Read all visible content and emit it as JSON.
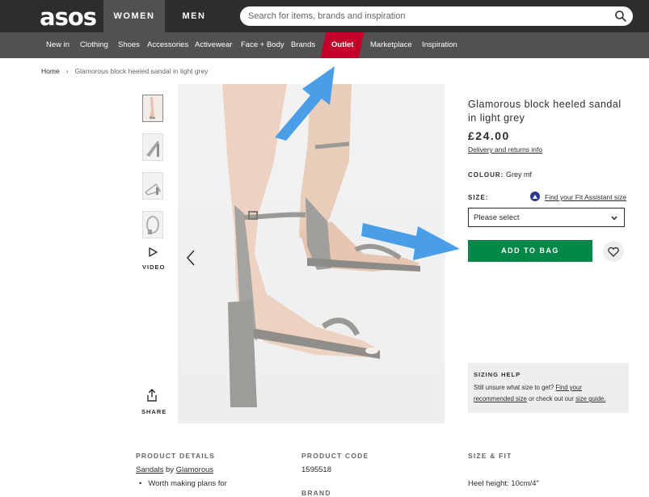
{
  "header": {
    "logo": "asos",
    "tab_women": "WOMEN",
    "tab_men": "MEN",
    "search_placeholder": "Search for items, brands and inspiration"
  },
  "nav": {
    "items": [
      "New in",
      "Clothing",
      "Shoes",
      "Accessories",
      "Activewear",
      "Face + Body",
      "Brands",
      "Outlet",
      "Marketplace",
      "Inspiration"
    ]
  },
  "breadcrumb": {
    "home": "Home",
    "separator": "›",
    "current": "Glamorous block heeled sandal in light grey"
  },
  "gallery": {
    "video_label": "VIDEO",
    "share_label": "SHARE"
  },
  "product": {
    "title": "Glamorous block heeled sandal in light grey",
    "price": "£24.00",
    "delivery_link": "Delivery and returns info",
    "colour_label": "COLOUR:",
    "colour_value": "Grey mf",
    "size_label": "SIZE:",
    "fit_link": "Find your Fit Assistant size",
    "size_select": "Please select",
    "add_to_bag": "ADD TO BAG"
  },
  "sizing_help": {
    "title": "SIZING HELP",
    "line1_prefix": "Still unsure what size to get?",
    "line1_link": "Find your",
    "line2_link": "recommended size",
    "line2_middle": "or check out our",
    "line2_link2": "size guide."
  },
  "details": {
    "product_details_head": "PRODUCT DETAILS",
    "product_code_head": "PRODUCT CODE",
    "size_fit_head": "SIZE & FIT",
    "category_link": "Sandals",
    "by": "by",
    "brand_link": "Glamorous",
    "bullet1": "Worth making plans for",
    "product_code": "1595518",
    "brand_head": "BRAND",
    "heel_height": "Heel height: 10cm/4\""
  },
  "colors": {
    "header_bg": "#2d2d2d",
    "nav_bg": "#525050",
    "outlet_bg": "#c4002a",
    "add_to_bag_bg": "#018849",
    "annotation_arrow": "#4a9ee8"
  }
}
